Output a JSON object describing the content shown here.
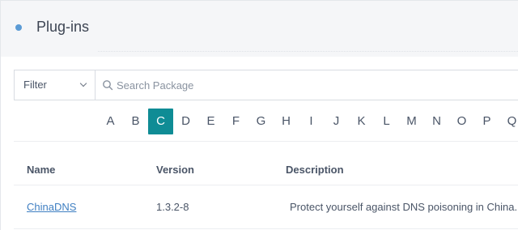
{
  "header": {
    "title": "Plug-ins"
  },
  "toolbar": {
    "filter_label": "Filter",
    "search_placeholder": "Search Package"
  },
  "alphabet": {
    "letters": [
      "A",
      "B",
      "C",
      "D",
      "E",
      "F",
      "G",
      "H",
      "I",
      "J",
      "K",
      "L",
      "M",
      "N",
      "O",
      "P",
      "Q"
    ],
    "active": "C"
  },
  "table": {
    "columns": [
      "Name",
      "Version",
      "Description"
    ],
    "rows": [
      {
        "name": "ChinaDNS",
        "version": "1.3.2-8",
        "description": "Protect yourself against DNS poisoning in China."
      }
    ]
  },
  "colors": {
    "accent": "#0f8c95",
    "link": "#3f7fc2",
    "header_dot": "#5b9bd5"
  }
}
